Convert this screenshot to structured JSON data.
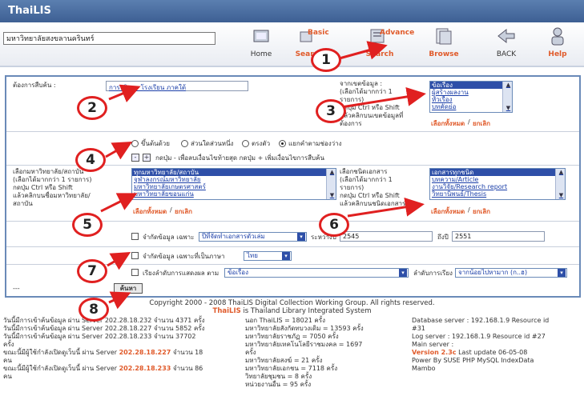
{
  "app": {
    "title": "ThaiLIS"
  },
  "institution_input": {
    "value": "มหาวิทยาลัยสงขลานครินทร์"
  },
  "nav": {
    "home": "Home",
    "basic_top": "Basic",
    "basic_bottom": "Search",
    "advance_top": "Advance",
    "advance_bottom": "Search",
    "browse": "Browse",
    "back": "BACK",
    "help": "Help"
  },
  "form": {
    "search_label": "ต้องการสืบค้น :",
    "search_value": "การบริหาร โรงเรียน ภาคใต้",
    "field_label": [
      "จากเขตข้อมูล :",
      "(เลือกได้มากกว่า 1",
      "รายการ)",
      "กดปุ่ม Ctrl หรือ Shift",
      "แล้วคลิกบนเขตข้อมูลที่",
      "ต้องการ"
    ],
    "field_options": [
      "ข้อเรื่อง",
      "ผู้สร้างผลงาน",
      "หัวเรื่อง",
      "บทคัดย่อ"
    ],
    "select_all": "เลือกทั้งหมด",
    "slash": "/",
    "cancel": "ยกเลิก",
    "radio_options": [
      "ขึ้นต้นด้วย",
      "ส่วนใดส่วนหนึ่ง",
      "ตรงตัว",
      "แยกคำตามช่องว่าง"
    ],
    "toggle_text": "กดปุ่ม - เพื่อลบเงื่อนไขท้ายสุด กดปุ่ม + เพิ่มเงื่อนไขการสืบค้น",
    "inst_label": [
      "เลือกมหาวิทยาลัย/สถาบัน",
      "(เลือกได้มากกว่า 1 รายการ)",
      "กดปุ่ม Ctrl หรือ Shift",
      "แล้วคลิกบนชื่อมหาวิทยาลัย/",
      "สถาบัน"
    ],
    "inst_options": [
      "ทุกมหาวิทยาลัย/สถาบัน",
      "จุฬาลงกรณ์มหาวิทยาลัย",
      "มหาวิทยาลัยเกษตรศาสตร์",
      "มหาวิทยาลัยขอนแก่น"
    ],
    "doc_label": [
      "เลือกชนิดเอกสาร",
      "(เลือกได้มากกว่า 1",
      "รายการ)",
      "กดปุ่ม Ctrl หรือ Shift",
      "แล้วคลิกบนชนิดเอกสาร"
    ],
    "doc_options": [
      "เอกสารทุกชนิด",
      "บทความ/Article",
      "งานวิจัย/Research report",
      "วิทยานิพนธ์/Thesis"
    ],
    "limit_year_label": "จำกัดข้อมูล เฉพาะ",
    "limit_year_select": "ปีที่จัดทำเอกสารตัวเล่ม",
    "between": "ระหว่างปี",
    "year_from": "2545",
    "to": "ถึงปี",
    "year_to": "2551",
    "lang_label": "จำกัดข้อมูล เฉพาะที่เป็นภาษา",
    "lang_select": "ไทย",
    "sort_label": "เรียงลำดับการแสดงผล ตาม",
    "sort_select": "ข้อเรื่อง",
    "order_label": "ลำดับการเรียง",
    "order_select": "จากน้อยไปหามาก (ก..ฮ)",
    "dashes": "---",
    "search_button": "ค้นหา"
  },
  "footer": {
    "copyright": "Copyright 2000 - 2008 ThaiLIS Digital Collection Working Group. All rights reserved.",
    "brand": "ThaiLIS",
    "tagline": "is Thailand Library Integrated System",
    "stats_left": [
      "วันนี้มีการเข้าค้นข้อมูล ผ่าน Server 202.28.18.232 จำนวน 4371 ครั้ง",
      "วันนี้มีการเข้าค้นข้อมูล ผ่าน Server 202.28.18.227 จำนวน 5852 ครั้ง",
      "วันนี้มีการเข้าค้นข้อมูล ผ่าน Server 202.28.18.233 จำนวน 37702",
      "ครั้ง"
    ],
    "online_1_pre": "ขณะนี้มีผู้ใช้กำลังเปิดดูเว็บนี้ ผ่าน Server",
    "online_1_ip": "202.28.18.227",
    "online_1_post": "จำนวน 18",
    "online_1_unit": "คน",
    "online_2_pre": "ขณะนี้มีผู้ใช้กำลังเปิดดูเว็บนี้ ผ่าน Server",
    "online_2_ip": "202.28.18.233",
    "online_2_post": "จำนวน 86",
    "online_2_unit": "คน",
    "stats_mid": [
      "นอก ThaiLIS = 18021 ครั้ง",
      "มหาวิทยาลัยสังกัดทบวงเดิม = 13593 ครั้ง",
      "มหาวิทยาลัยราชภัฏ = 7050 ครั้ง",
      "มหาวิทยาลัยเทคโนโลยีราชมงคล = 1697",
      "ครั้ง",
      "มหาวิทยาลัยสงฆ์ = 21 ครั้ง",
      "มหาวิทยาลัยเอกชน = 7118 ครั้ง",
      "วิทยาลัยชุมชน = 8 ครั้ง",
      "หน่วยงานอื่น = 95 ครั้ง"
    ],
    "stats_right": [
      "Database server : 192.168.1.9 Resource id",
      "#31",
      "Log server : 192.168.1.9 Resource id #27",
      "Main server :"
    ],
    "version": "Version 2.3c",
    "last_update": "Last update 06-05-08",
    "power": [
      "Power By SUSE PHP MySQL IndexData",
      "Mambo"
    ]
  },
  "annotations": [
    "1",
    "2",
    "3",
    "4",
    "5",
    "6",
    "7",
    "8"
  ],
  "colors": {
    "accent": "#e05a2a",
    "title_bg": "#4a6ea3",
    "annotation": "#e02020",
    "list_sel": "#2e4fa8"
  }
}
